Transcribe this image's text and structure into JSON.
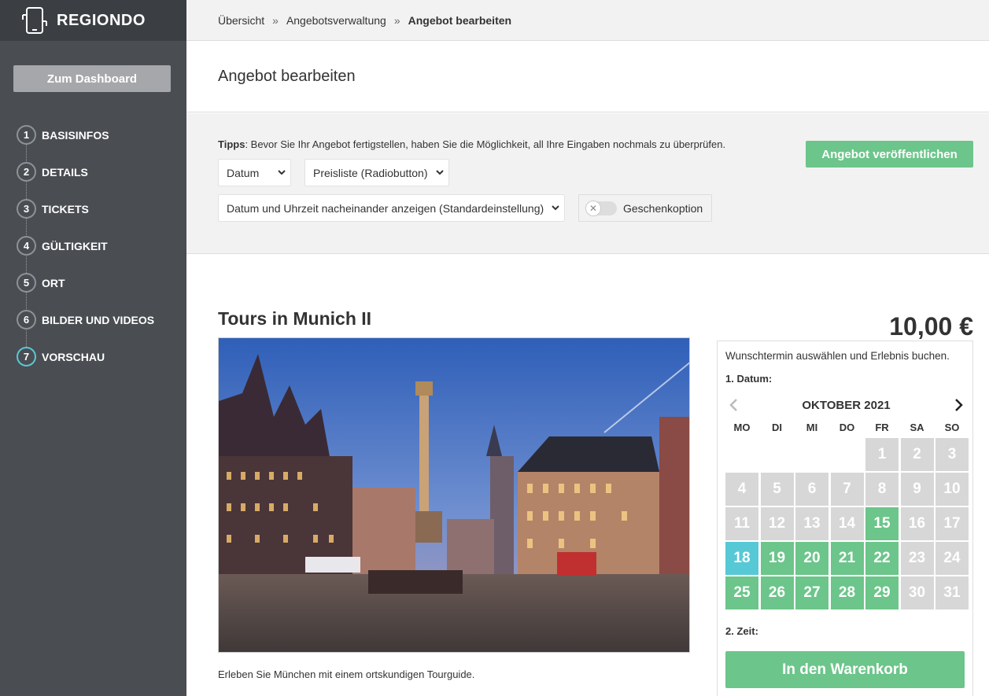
{
  "app": {
    "logo_text": "REGIONDO"
  },
  "sidebar": {
    "dashboard_label": "Zum Dashboard",
    "steps": [
      {
        "num": "1",
        "label": "BASISINFOS"
      },
      {
        "num": "2",
        "label": "DETAILS"
      },
      {
        "num": "3",
        "label": "TICKETS"
      },
      {
        "num": "4",
        "label": "GÜLTIGKEIT"
      },
      {
        "num": "5",
        "label": "ORT"
      },
      {
        "num": "6",
        "label": "BILDER UND VIDEOS"
      },
      {
        "num": "7",
        "label": "VORSCHAU"
      }
    ]
  },
  "breadcrumb": {
    "items": [
      "Übersicht",
      "Angebotsverwaltung",
      "Angebot bearbeiten"
    ],
    "separator": "»"
  },
  "page": {
    "title": "Angebot bearbeiten"
  },
  "tips": {
    "label": "Tipps",
    "text": ": Bevor Sie Ihr Angebot fertigstellen, haben Sie die Möglichkeit, all Ihre Eingaben nochmals zu überprüfen.",
    "date_select": "Datum",
    "pricelist_select": "Preisliste (Radiobutton)",
    "display_select": "Datum und Uhrzeit nacheinander anzeigen (Standardeinstellung)",
    "gift_label": "Geschenkoption",
    "publish_label": "Angebot veröffentlichen"
  },
  "preview": {
    "title": "Tours in Munich II",
    "description": "Erleben Sie München mit einem ortskundigen Tourguide.",
    "price": "10,00 €"
  },
  "booking": {
    "intro": "Wunschtermin auswählen und Erlebnis buchen.",
    "date_label": "1. Datum:",
    "month": "OKTOBER 2021",
    "weekdays": [
      "MO",
      "DI",
      "MI",
      "DO",
      "FR",
      "SA",
      "SO"
    ],
    "days": [
      [
        "",
        "empty"
      ],
      [
        "",
        "empty"
      ],
      [
        "",
        "empty"
      ],
      [
        "",
        "empty"
      ],
      [
        "1",
        "unavail"
      ],
      [
        "2",
        "unavail"
      ],
      [
        "3",
        "unavail"
      ],
      [
        "4",
        "unavail"
      ],
      [
        "5",
        "unavail"
      ],
      [
        "6",
        "unavail"
      ],
      [
        "7",
        "unavail"
      ],
      [
        "8",
        "unavail"
      ],
      [
        "9",
        "unavail"
      ],
      [
        "10",
        "unavail"
      ],
      [
        "11",
        "unavail"
      ],
      [
        "12",
        "unavail"
      ],
      [
        "13",
        "unavail"
      ],
      [
        "14",
        "unavail"
      ],
      [
        "15",
        "avail"
      ],
      [
        "16",
        "unavail"
      ],
      [
        "17",
        "unavail"
      ],
      [
        "18",
        "selected"
      ],
      [
        "19",
        "avail"
      ],
      [
        "20",
        "avail"
      ],
      [
        "21",
        "avail"
      ],
      [
        "22",
        "avail"
      ],
      [
        "23",
        "unavail"
      ],
      [
        "24",
        "unavail"
      ],
      [
        "25",
        "avail"
      ],
      [
        "26",
        "avail"
      ],
      [
        "27",
        "avail"
      ],
      [
        "28",
        "avail"
      ],
      [
        "29",
        "avail"
      ],
      [
        "30",
        "unavail"
      ],
      [
        "31",
        "unavail"
      ]
    ],
    "time_label": "2. Zeit:",
    "cart_label": "In den Warenkorb"
  },
  "colors": {
    "accent_green": "#6cc58a",
    "accent_cyan": "#57c8d6",
    "sidebar_bg": "#4a4d52",
    "unavailable_day": "#d7d7d7"
  }
}
